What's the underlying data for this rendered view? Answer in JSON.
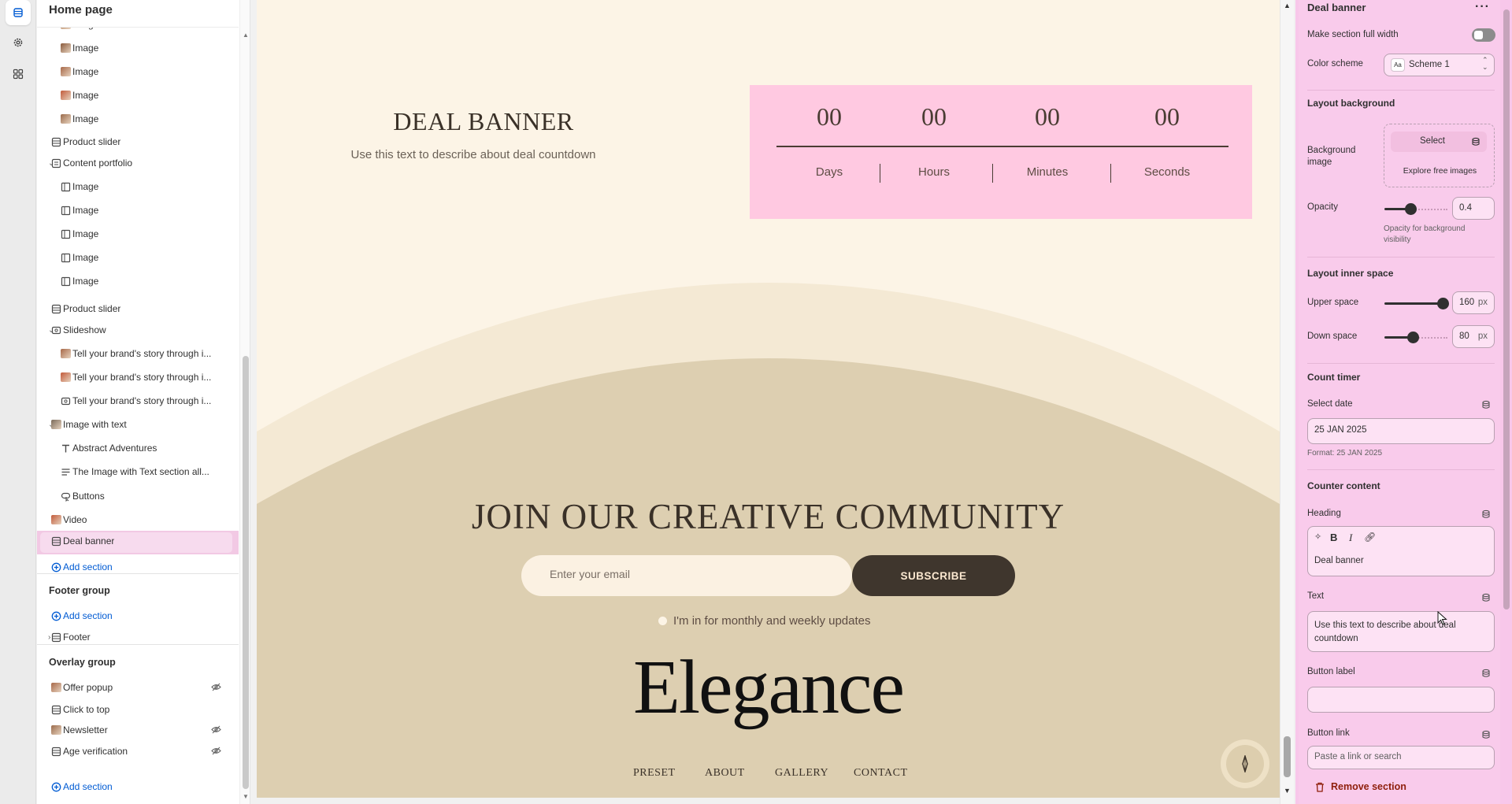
{
  "sidebar": {
    "title": "Home page",
    "items": [
      {
        "label": "Image",
        "icon": "thumbnail"
      },
      {
        "label": "Image",
        "icon": "thumbnail"
      },
      {
        "label": "Image",
        "icon": "thumbnail"
      },
      {
        "label": "Image",
        "icon": "thumbnail"
      },
      {
        "label": "Image",
        "icon": "thumbnail"
      },
      {
        "label": "Product slider",
        "icon": "section-icon"
      },
      {
        "label": "Content portfolio",
        "icon": "portfolio-icon"
      },
      {
        "label": "Image",
        "icon": "block-icon"
      },
      {
        "label": "Image",
        "icon": "block-icon"
      },
      {
        "label": "Image",
        "icon": "block-icon"
      },
      {
        "label": "Image",
        "icon": "block-icon"
      },
      {
        "label": "Image",
        "icon": "block-icon"
      },
      {
        "label": "Product slider",
        "icon": "section-icon"
      },
      {
        "label": "Slideshow",
        "icon": "slideshow-icon"
      },
      {
        "label": "Tell your brand's story through i...",
        "icon": "thumbnail"
      },
      {
        "label": "Tell your brand's story through i...",
        "icon": "thumbnail"
      },
      {
        "label": "Tell your brand's story through i...",
        "icon": "slideshow-icon"
      },
      {
        "label": "Image with text",
        "icon": "thumbnail"
      },
      {
        "label": "Abstract Adventures",
        "icon": "text-icon"
      },
      {
        "label": "The Image with Text section all...",
        "icon": "paragraph-icon"
      },
      {
        "label": "Buttons",
        "icon": "button-icon"
      },
      {
        "label": "Video",
        "icon": "thumbnail"
      },
      {
        "label": "Deal banner",
        "icon": "section-icon"
      }
    ],
    "add_section": "Add section",
    "footer_group": {
      "title": "Footer group",
      "add_section": "Add section",
      "footer": "Footer"
    },
    "overlay_group": {
      "title": "Overlay group",
      "items": [
        "Offer popup",
        "Click to top",
        "Newsletter",
        "Age verification"
      ],
      "add_section": "Add section"
    }
  },
  "preview": {
    "deal_title": "DEAL BANNER",
    "deal_text": "Use this text to describe about deal countdown",
    "counter": {
      "values": [
        "00",
        "00",
        "00",
        "00"
      ],
      "labels": [
        "Days",
        "Hours",
        "Minutes",
        "Seconds"
      ]
    },
    "join_title": "JOIN OUR CREATIVE COMMUNITY",
    "email_placeholder": "Enter your email",
    "subscribe": "SUBSCRIBE",
    "updates": "I'm in for monthly and weekly updates",
    "logo": "Elegance",
    "nav": [
      "PRESET",
      "ABOUT",
      "GALLERY",
      "CONTACT"
    ]
  },
  "panel": {
    "title": "Deal banner",
    "full_width": "Make section full width",
    "color_scheme_label": "Color scheme",
    "color_scheme_value": "Scheme 1",
    "layout_background": "Layout background",
    "background_image": "Background image",
    "select": "Select",
    "explore": "Explore free images",
    "opacity_label": "Opacity",
    "opacity_value": "0.4",
    "opacity_help": "Opacity for background visibility",
    "inner_space": "Layout inner space",
    "upper_label": "Upper space",
    "upper_value": "160",
    "down_label": "Down space",
    "down_value": "80",
    "unit": "px",
    "count_timer": "Count timer",
    "select_date": "Select date",
    "date_value": "25 JAN 2025",
    "date_format": "Format: 25 JAN 2025",
    "counter_content": "Counter content",
    "heading_label": "Heading",
    "heading_value": "Deal banner",
    "text_label": "Text",
    "text_value": "Use this text to describe about deal countdown",
    "button_label": "Button label",
    "button_link": "Button link",
    "link_placeholder": "Paste a link or search",
    "remove": "Remove section"
  },
  "colors": {
    "accent_pink": "#f9cbeb",
    "counter_bg": "#ffc9e1",
    "link_blue": "#005bd3",
    "remove_red": "#8e1f0b"
  }
}
